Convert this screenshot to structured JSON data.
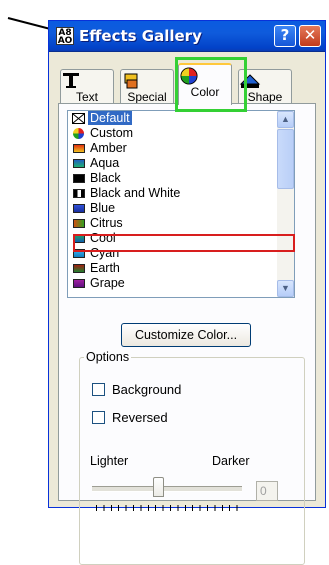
{
  "window": {
    "title": "Effects Gallery",
    "app_icon_text": [
      "A8",
      "AO"
    ],
    "help_glyph": "?",
    "close_glyph": "✕"
  },
  "tabs": [
    {
      "label": "Text",
      "icon": "text-tool-icon"
    },
    {
      "label": "Special",
      "icon": "special-effects-icon"
    },
    {
      "label": "Color",
      "icon": "color-wheel-icon",
      "active": true
    },
    {
      "label": "Shape",
      "icon": "shape-icon"
    }
  ],
  "list": {
    "items": [
      {
        "label": "Default",
        "swatch": "default-icon",
        "selected": true
      },
      {
        "label": "Custom",
        "swatch": "custom-icon"
      },
      {
        "label": "Amber",
        "swatch": "#f0a020"
      },
      {
        "label": "Aqua",
        "swatch": "#1e9e8e"
      },
      {
        "label": "Black",
        "swatch": "#000000"
      },
      {
        "label": "Black and White",
        "swatch": "#000000"
      },
      {
        "label": "Blue",
        "swatch": "#2848c8"
      },
      {
        "label": "Citrus",
        "swatch": "#28a028"
      },
      {
        "label": "Cool",
        "swatch": "#108878"
      },
      {
        "label": "Cyan",
        "swatch": "#30a0e0"
      },
      {
        "label": "Earth",
        "swatch": "#a03010"
      },
      {
        "label": "Grape",
        "swatch": "#8020a0"
      }
    ]
  },
  "customize_button": "Customize Color...",
  "options": {
    "legend": "Options",
    "background_label": "Background",
    "reversed_label": "Reversed",
    "lighter_label": "Lighter",
    "darker_label": "Darker",
    "slider_value": "0",
    "slider_level": 0.45
  },
  "colors": {
    "highlight_tab": "#34d034",
    "highlight_item": "#d81e1e",
    "selection": "#316ac5"
  }
}
